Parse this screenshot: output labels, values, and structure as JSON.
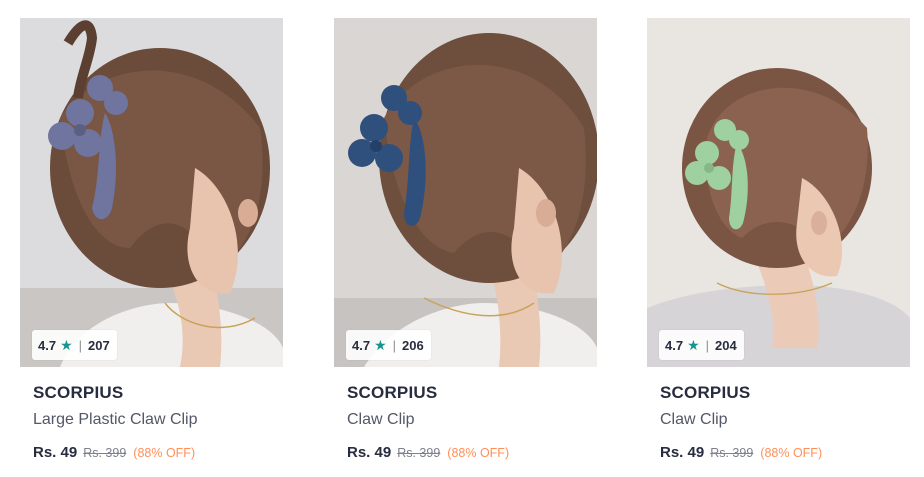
{
  "products": [
    {
      "brand": "SCORPIUS",
      "name": "Large Plastic Claw Clip",
      "rating": "4.7",
      "rating_count": "207",
      "price": "Rs. 49",
      "mrp": "Rs. 399",
      "discount": "(88% OFF)",
      "clip_color": "#6f759e"
    },
    {
      "brand": "SCORPIUS",
      "name": "Claw Clip",
      "rating": "4.7",
      "rating_count": "206",
      "price": "Rs. 49",
      "mrp": "Rs. 399",
      "discount": "(88% OFF)",
      "clip_color": "#2f4f7d"
    },
    {
      "brand": "SCORPIUS",
      "name": "Claw Clip",
      "rating": "4.7",
      "rating_count": "204",
      "price": "Rs. 49",
      "mrp": "Rs. 399",
      "discount": "(88% OFF)",
      "clip_color": "#9fd0a0"
    }
  ],
  "icons": {
    "rating": "star-icon"
  },
  "colors": {
    "star": "#14958f",
    "discount": "#ff905a",
    "text_primary": "#282c3f",
    "text_secondary": "#535766",
    "text_muted": "#7e818c"
  }
}
